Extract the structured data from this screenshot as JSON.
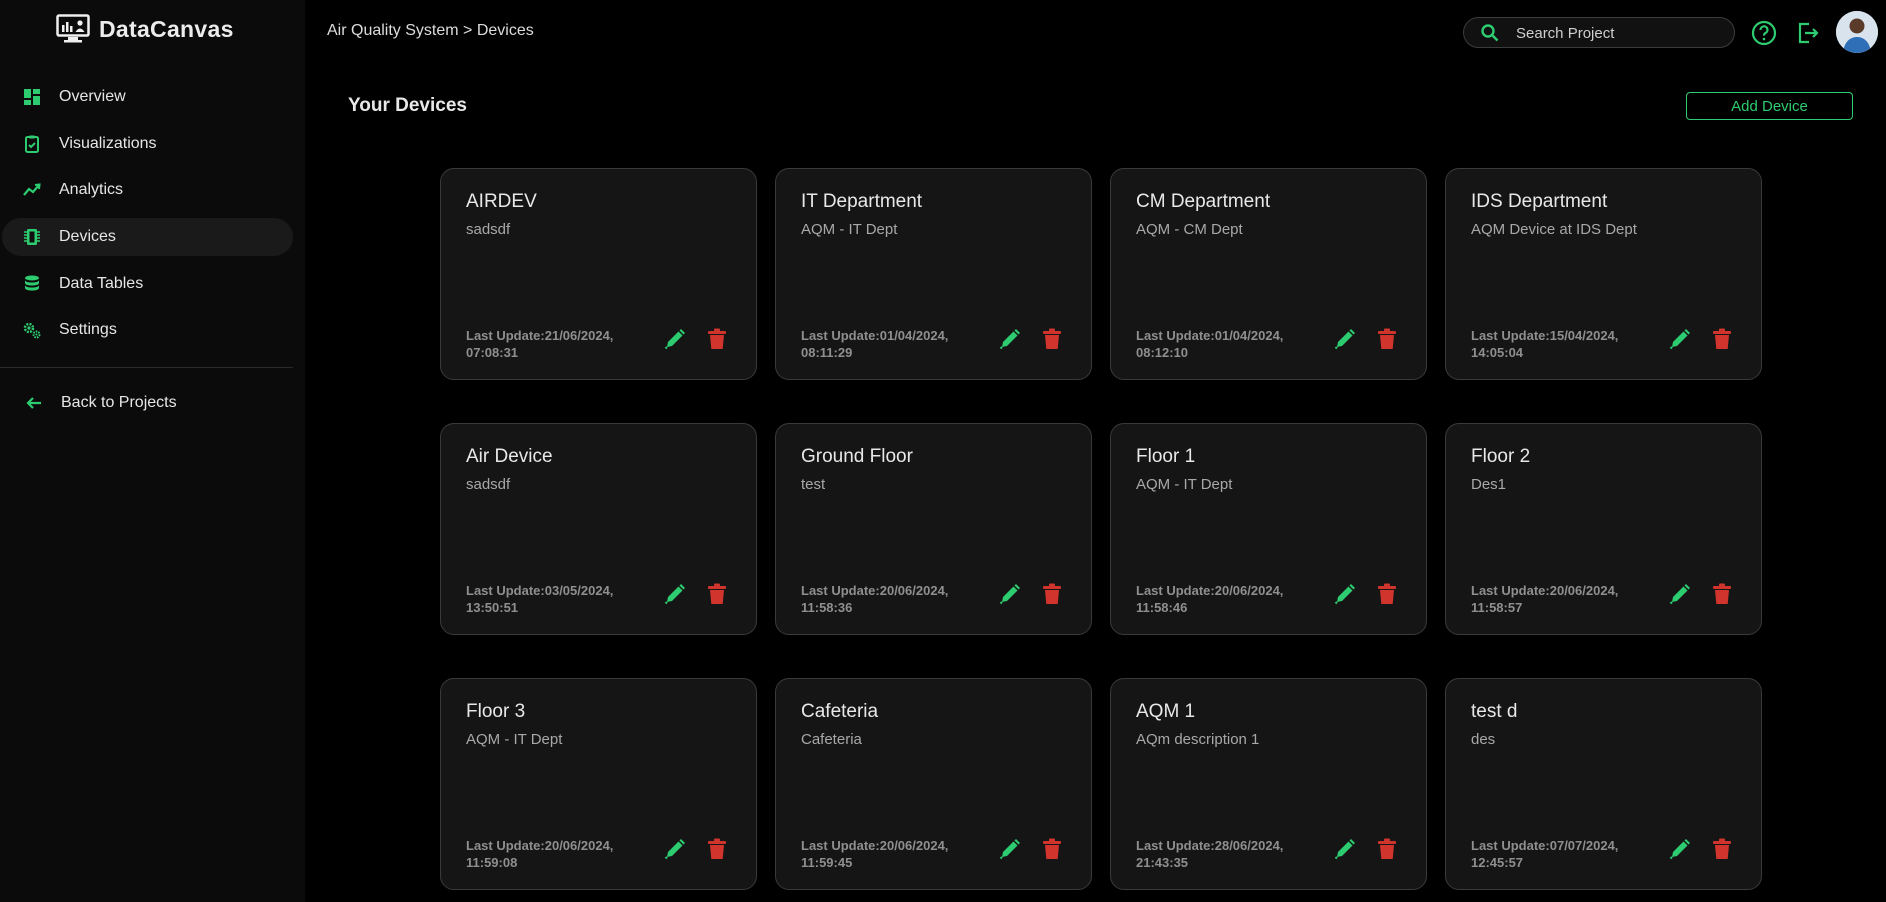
{
  "app": {
    "name": "DataCanvas"
  },
  "sidebar": {
    "items": [
      {
        "label": "Overview",
        "icon": "dashboard-icon"
      },
      {
        "label": "Visualizations",
        "icon": "clipboard-icon"
      },
      {
        "label": "Analytics",
        "icon": "trend-icon"
      },
      {
        "label": "Devices",
        "icon": "chip-icon",
        "active": true
      },
      {
        "label": "Data Tables",
        "icon": "database-icon"
      },
      {
        "label": "Settings",
        "icon": "gears-icon"
      }
    ],
    "back_label": "Back to Projects"
  },
  "header": {
    "breadcrumb": "Air Quality System > Devices",
    "search_placeholder": "Search Project"
  },
  "main": {
    "title": "Your Devices",
    "add_label": "Add Device",
    "devices": [
      {
        "name": "AIRDEV",
        "description": "sadsdf",
        "last_update": "Last Update:21/06/2024, 07:08:31"
      },
      {
        "name": "IT Department",
        "description": "AQM - IT Dept",
        "last_update": "Last Update:01/04/2024, 08:11:29"
      },
      {
        "name": "CM Department",
        "description": "AQM - CM Dept",
        "last_update": "Last Update:01/04/2024, 08:12:10"
      },
      {
        "name": "IDS Department",
        "description": "AQM Device at IDS Dept",
        "last_update": "Last Update:15/04/2024, 14:05:04"
      },
      {
        "name": "Air Device",
        "description": "sadsdf",
        "last_update": "Last Update:03/05/2024, 13:50:51"
      },
      {
        "name": "Ground Floor",
        "description": "test",
        "last_update": "Last Update:20/06/2024, 11:58:36"
      },
      {
        "name": "Floor 1",
        "description": "AQM - IT Dept",
        "last_update": "Last Update:20/06/2024, 11:58:46"
      },
      {
        "name": "Floor 2",
        "description": "Des1",
        "last_update": "Last Update:20/06/2024, 11:58:57"
      },
      {
        "name": "Floor 3",
        "description": "AQM - IT Dept",
        "last_update": "Last Update:20/06/2024, 11:59:08"
      },
      {
        "name": "Cafeteria",
        "description": "Cafeteria",
        "last_update": "Last Update:20/06/2024, 11:59:45"
      },
      {
        "name": "AQM 1",
        "description": "AQm description 1",
        "last_update": "Last Update:28/06/2024, 21:43:35"
      },
      {
        "name": "test d",
        "description": "des",
        "last_update": "Last Update:07/07/2024, 12:45:57"
      }
    ]
  },
  "colors": {
    "accent": "#2ecc71",
    "danger": "#d0342c",
    "background": "#000000",
    "card": "#151515"
  }
}
